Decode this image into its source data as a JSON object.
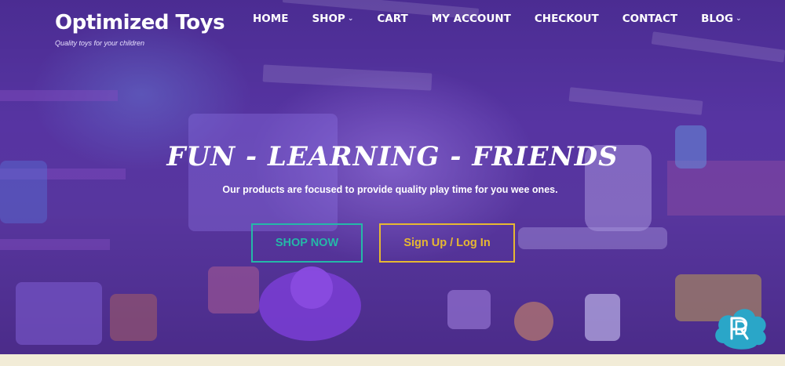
{
  "brand": {
    "title": "Optimized Toys",
    "tagline": "Quality toys for your children"
  },
  "nav": {
    "items": [
      {
        "label": "HOME",
        "has_dropdown": false
      },
      {
        "label": "SHOP",
        "has_dropdown": true
      },
      {
        "label": "CART",
        "has_dropdown": false
      },
      {
        "label": "MY ACCOUNT",
        "has_dropdown": false
      },
      {
        "label": "CHECKOUT",
        "has_dropdown": false
      },
      {
        "label": "CONTACT",
        "has_dropdown": false
      },
      {
        "label": "BLOG",
        "has_dropdown": true
      }
    ],
    "dropdown_glyph": "⌄"
  },
  "hero": {
    "headline": "FUN - LEARNING - FRIENDS",
    "subline": "Our products are focused to provide quality play time for you wee ones.",
    "shop_button": "SHOP NOW",
    "signup_button": "Sign Up / Log In"
  },
  "colors": {
    "shop_accent": "#25b8a8",
    "signup_accent": "#e6b832",
    "hero_tint": "#5a3aa0",
    "badge": "#2aa6c8"
  },
  "badge": {
    "icon": "dr-logo-icon"
  }
}
